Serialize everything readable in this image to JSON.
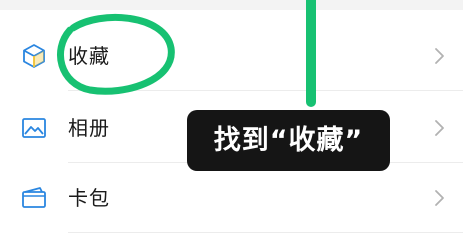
{
  "menu": {
    "items": [
      {
        "label": "收藏",
        "icon": "cube-icon"
      },
      {
        "label": "相册",
        "icon": "image-icon"
      },
      {
        "label": "卡包",
        "icon": "card-wallet-icon"
      }
    ]
  },
  "annotation": {
    "tooltip_text": "找到“收藏”",
    "highlight_color": "#17c172",
    "tooltip_bg": "#151515"
  },
  "colors": {
    "icon_blue": "#2a86e0",
    "icon_yellow": "#f2c230",
    "chevron": "#b2b2b2"
  }
}
